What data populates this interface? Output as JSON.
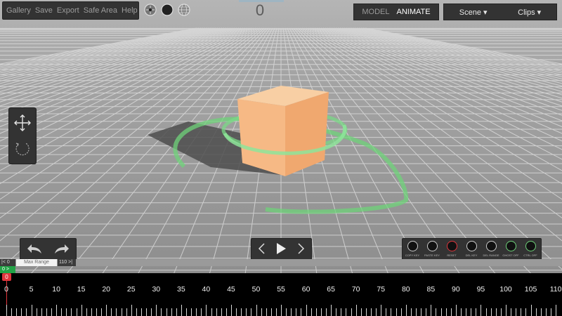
{
  "menu": {
    "items": [
      "Gallery",
      "Save",
      "Export",
      "Safe Area",
      "Help"
    ]
  },
  "frame_counter": "0",
  "mode": {
    "model": "MODEL",
    "animate": "ANIMATE"
  },
  "scene_menu": {
    "scene": "Scene ▾",
    "clips": "Clips ▾"
  },
  "key_buttons": [
    "COPY KEY",
    "PASTE KEY",
    "RESET",
    "DEL KEY",
    "DEL RANGE",
    "GHOST OFF",
    "CTRL OFF"
  ],
  "range": {
    "start": "|< 0",
    "max_label": "Max Range",
    "end": "110 >|",
    "green_label": "0 >"
  },
  "timeline": {
    "current_frame": "0",
    "labels": [
      "0",
      "5",
      "10",
      "15",
      "20",
      "25",
      "30",
      "35",
      "40",
      "45",
      "50",
      "55",
      "60",
      "65",
      "70",
      "75",
      "80",
      "85",
      "90",
      "95",
      "100",
      "105",
      "110"
    ]
  },
  "colors": {
    "accent_green": "#23a347",
    "playhead_red": "#e0363c",
    "cube": "#f6b985",
    "gizmo_green": "#6fd37a",
    "panel_bg": "#333333"
  }
}
